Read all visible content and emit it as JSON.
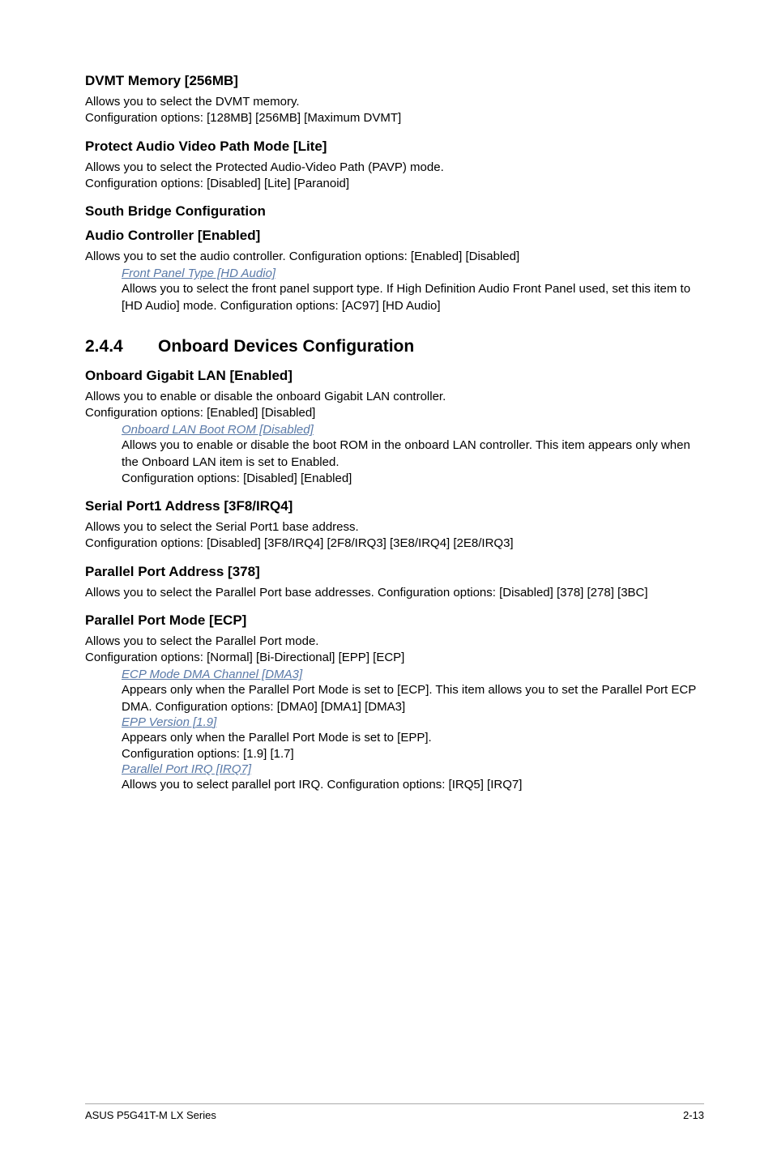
{
  "sections": {
    "dvmt": {
      "heading": "DVMT Memory [256MB]",
      "p1": "Allows you to select the DVMT memory.",
      "p2": "Configuration options: [128MB] [256MB] [Maximum DVMT]"
    },
    "pavp": {
      "heading": "Protect Audio Video Path Mode [Lite]",
      "p1": "Allows you to select the Protected Audio-Video Path (PAVP) mode.",
      "p2": "Configuration options: [Disabled] [Lite] [Paranoid]"
    },
    "south": {
      "heading": "South Bridge Configuration"
    },
    "audio": {
      "heading": "Audio Controller [Enabled]",
      "p1": "Allows you to set the audio controller. Configuration options: [Enabled] [Disabled]",
      "sub": {
        "title": "Front Panel Type [HD Audio]",
        "text": "Allows you to select the front panel support type. If High Definition Audio Front Panel used, set this item to [HD Audio] mode. Configuration options: [AC97] [HD Audio]"
      }
    },
    "onboard": {
      "num": "2.4.4",
      "title": "Onboard Devices Configuration"
    },
    "giglan": {
      "heading": "Onboard Gigabit LAN [Enabled]",
      "p1": "Allows you to enable or disable the onboard Gigabit LAN controller.",
      "p2": "Configuration options: [Enabled] [Disabled]",
      "sub": {
        "title": "Onboard LAN Boot ROM [Disabled]",
        "text": "Allows you to enable or disable the boot ROM in the onboard LAN controller. This item appears only when the Onboard LAN item is set to Enabled.",
        "text2": "Configuration options: [Disabled] [Enabled]"
      }
    },
    "serial": {
      "heading": "Serial Port1 Address [3F8/IRQ4]",
      "p1": "Allows you to select the Serial Port1 base address.",
      "p2": "Configuration options: [Disabled] [3F8/IRQ4] [2F8/IRQ3] [3E8/IRQ4] [2E8/IRQ3]"
    },
    "paraddr": {
      "heading": "Parallel Port Address [378]",
      "p1": "Allows you to select the Parallel Port base addresses. Configuration options: [Disabled] [378] [278] [3BC]"
    },
    "parmode": {
      "heading": "Parallel Port Mode [ECP]",
      "p1": "Allows you to select the Parallel Port mode.",
      "p2": "Configuration options: [Normal] [Bi-Directional] [EPP] [ECP]",
      "sub1": {
        "title": "ECP Mode DMA Channel [DMA3]",
        "text": "Appears only when the Parallel Port Mode is set to [ECP]. This item allows you to set the Parallel Port ECP DMA. Configuration options: [DMA0] [DMA1] [DMA3]"
      },
      "sub2": {
        "title": "EPP Version [1.9]",
        "text": "Appears only when the Parallel Port Mode is set to [EPP].",
        "text2": "Configuration options: [1.9] [1.7]"
      },
      "sub3": {
        "title": "Parallel Port IRQ [IRQ7]",
        "text": "Allows you to select parallel port IRQ. Configuration options: [IRQ5] [IRQ7]"
      }
    }
  },
  "footer": {
    "left": "ASUS P5G41T-M LX Series",
    "right": "2-13"
  }
}
